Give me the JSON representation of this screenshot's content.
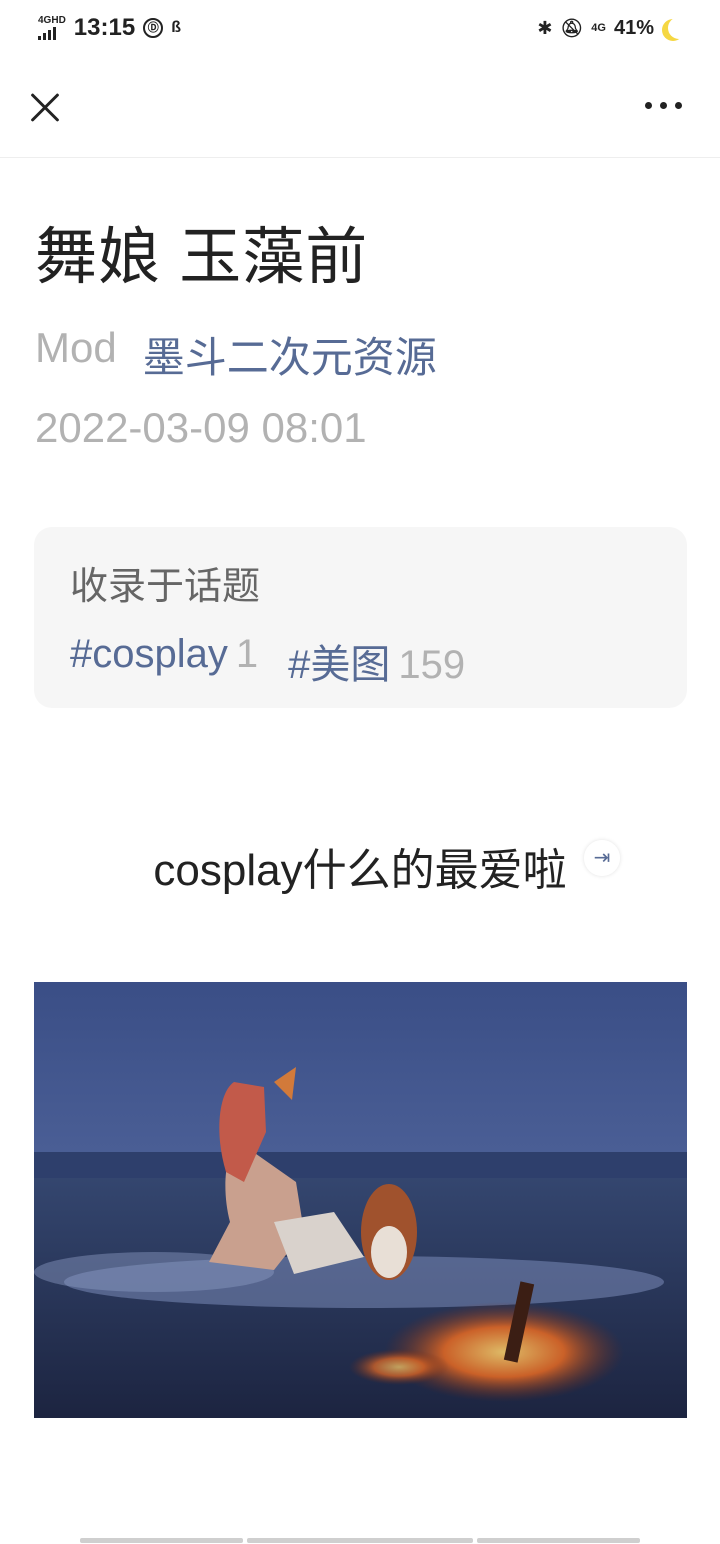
{
  "status_bar": {
    "network": "4G",
    "network_sub": "HD",
    "time": "13:15",
    "icon_1": "Ⓓ",
    "icon_2": "ß",
    "network_right": "4G",
    "battery": "41%"
  },
  "article": {
    "title": "舞娘 玉藻前",
    "author": "Mod",
    "account": "墨斗二次元资源",
    "date": "2022-03-09 08:01",
    "topics_heading": "收录于话题",
    "tags": [
      {
        "name": "#cosplay",
        "count": "1"
      },
      {
        "name": "#美图",
        "count": "159"
      }
    ],
    "lead_text": "cosplay什么的最爱啦"
  },
  "colors": {
    "link": "#576b95",
    "muted": "#b2b2b2",
    "topic_bg": "#f6f6f6"
  },
  "icons": {
    "close": "close-icon",
    "more": "more-icon",
    "expand": "expand-icon"
  }
}
